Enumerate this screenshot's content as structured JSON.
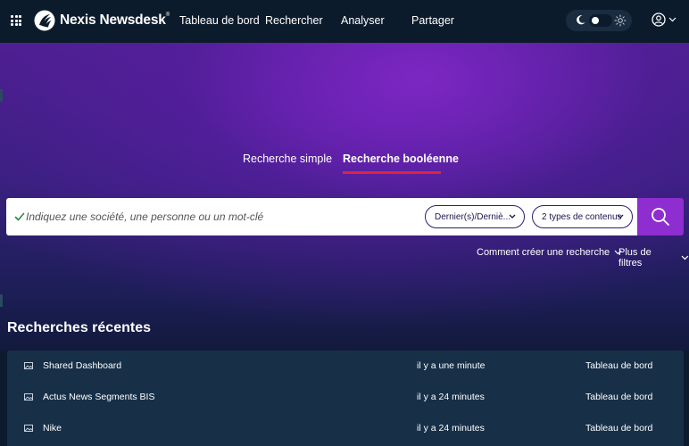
{
  "brand": {
    "name": "Nexis Newsdesk",
    "trademark": "®"
  },
  "nav": [
    {
      "label": "Tableau de bord"
    },
    {
      "label": "Rechercher"
    },
    {
      "label": "Analyser"
    },
    {
      "label": "Partager"
    }
  ],
  "icons": {
    "apps": "grid-icon",
    "theme_dark": "moon-icon",
    "theme_light": "sun-icon",
    "account": "user-circle-icon",
    "search": "magnifier-icon",
    "valid": "check-icon",
    "row": "image-icon"
  },
  "tabs": [
    {
      "label": "Recherche simple",
      "active": false
    },
    {
      "label": "Recherche booléenne",
      "active": true
    }
  ],
  "search": {
    "placeholder": "Indiquez une société, une personne ou un mot-clé",
    "value": "",
    "date_filter": "Dernier(s)/Derniè...",
    "content_filter": "2 types de contenus"
  },
  "links": {
    "how_to": "Comment créer une recherche",
    "more_filters": "Plus de filtres"
  },
  "recent": {
    "title": "Recherches récentes",
    "rows": [
      {
        "name": "Shared Dashboard",
        "time": "il y a une minute",
        "type": "Tableau de bord"
      },
      {
        "name": "Actus News Segments BIS",
        "time": "il y a 24 minutes",
        "type": "Tableau de bord"
      },
      {
        "name": "Nike",
        "time": "il y a 24 minutes",
        "type": "Tableau de bord"
      }
    ]
  },
  "colors": {
    "topbar": "#0c1b2c",
    "accent_purple": "#8e2dd0",
    "tab_underline": "#e0243a",
    "recent_panel": "#173048"
  }
}
